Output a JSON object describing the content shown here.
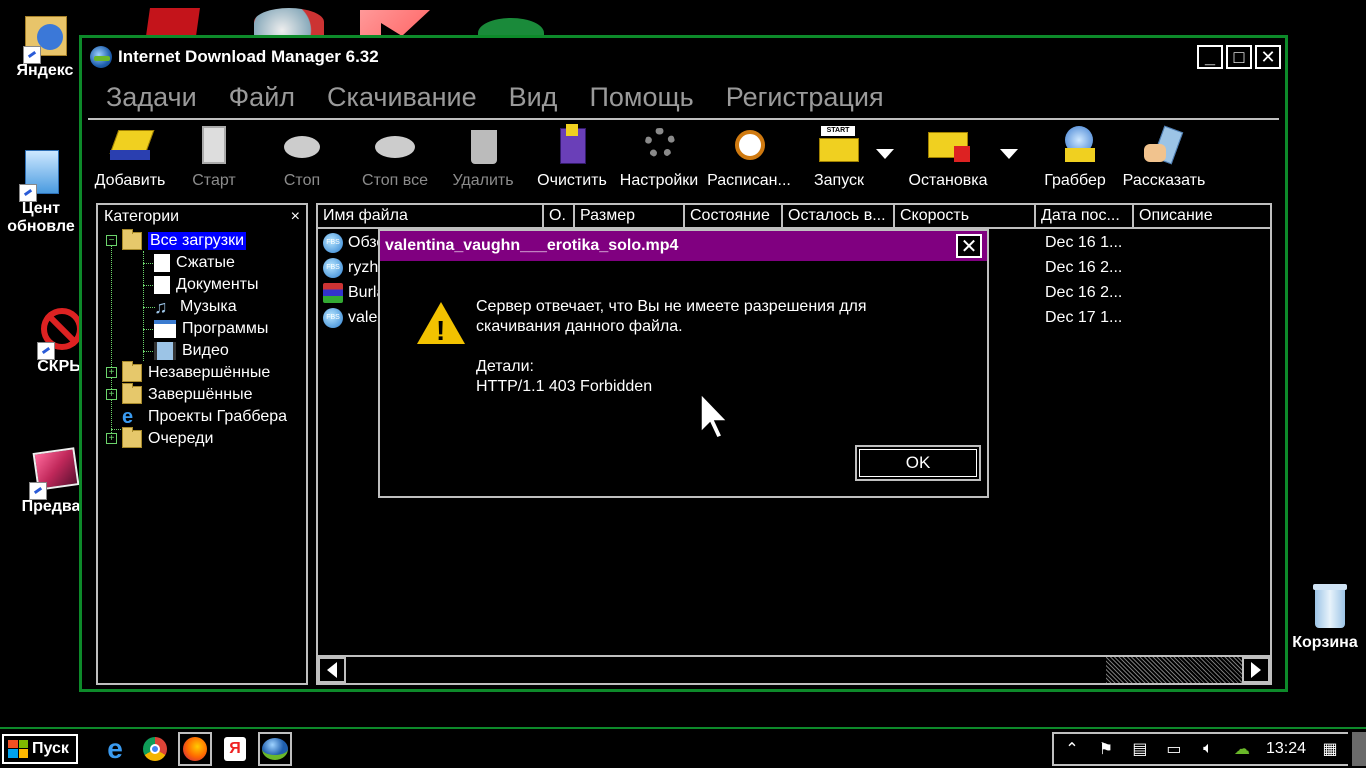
{
  "desktop": {
    "icons": [
      {
        "label": "Яндекс"
      },
      {
        "label": "Цент\nобновле"
      },
      {
        "label": "СКРЬ"
      },
      {
        "label": "Предва"
      },
      {
        "label": "Корзина"
      }
    ]
  },
  "window": {
    "title": "Internet Download Manager 6.32",
    "buttons": {
      "minimize": "_",
      "maximize": "□",
      "close": "✕"
    }
  },
  "menu": [
    "Задачи",
    "Файл",
    "Скачивание",
    "Вид",
    "Помощь",
    "Регистрация"
  ],
  "toolbar": {
    "add": "Добавить",
    "start": "Старт",
    "stop": "Стоп",
    "stop_all": "Стоп все",
    "delete": "Удалить",
    "clean": "Очистить",
    "settings": "Настройки",
    "schedule": "Расписан...",
    "run": "Запуск",
    "halt": "Остановка",
    "grabber": "Граббер",
    "tell": "Рассказать"
  },
  "categories": {
    "header": "Категории",
    "close": "×",
    "all": "Все загрузки",
    "compressed": "Сжатые",
    "documents": "Документы",
    "music": "Музыка",
    "programs": "Программы",
    "video": "Видео",
    "unfinished": "Незавершённые",
    "finished": "Завершённые",
    "grabber_projects": "Проекты Граббера",
    "queues": "Очереди"
  },
  "filelist": {
    "columns": [
      "Имя файла",
      "О.",
      "Размер",
      "Состояние",
      "Осталось в...",
      "Скорость",
      "Дата пос...",
      "Описание"
    ],
    "rows": [
      {
        "name": "Обзо",
        "date": "Dec 16 1...",
        "type": "video"
      },
      {
        "name": "ryzh",
        "date": "Dec 16 2...",
        "type": "video"
      },
      {
        "name": "Burla",
        "date": "Dec 16 2...",
        "type": "archive"
      },
      {
        "name": "valen",
        "date": "Dec 17 1...",
        "type": "video"
      }
    ]
  },
  "dialog": {
    "title": "valentina_vaughn___erotika_solo.mp4",
    "message_line1": "Сервер отвечает, что Вы не имеете разрешения для",
    "message_line2": "скачивания данного файла.",
    "details_label": "Детали:",
    "details_value": "HTTP/1.1 403 Forbidden",
    "ok": "OK"
  },
  "taskbar": {
    "start": "Пуск",
    "clock": "13:24"
  },
  "colors": {
    "window_border": "#0d8a2a",
    "dialog_title": "#800080",
    "selection": "#0000ff"
  }
}
